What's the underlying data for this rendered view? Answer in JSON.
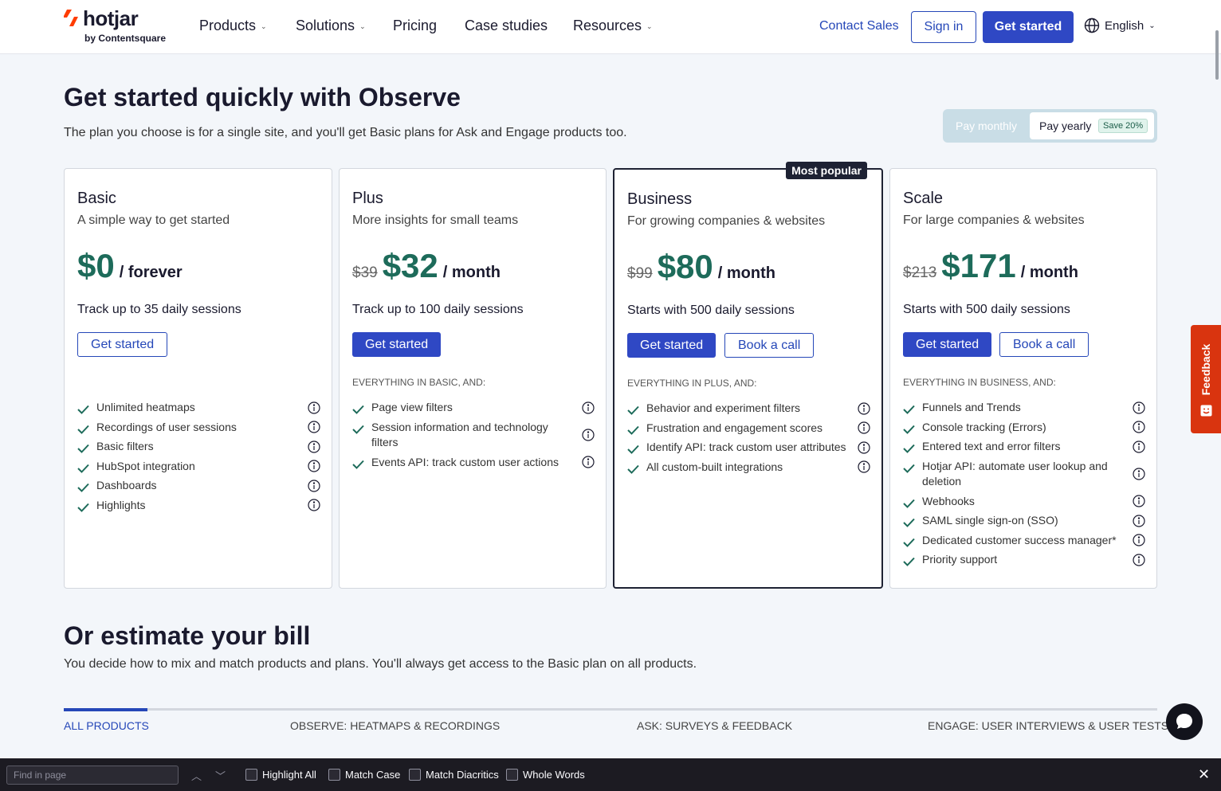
{
  "nav": {
    "logo": "hotjar",
    "logo_sub": "by Contentsquare",
    "items": [
      "Products",
      "Solutions",
      "Pricing",
      "Case studies",
      "Resources"
    ],
    "contact": "Contact Sales",
    "signin": "Sign in",
    "get_started": "Get started",
    "language": "English"
  },
  "hero": {
    "title": "Get started quickly with Observe",
    "subtitle": "The plan you choose is for a single site, and you'll get Basic plans for Ask and Engage products too."
  },
  "billing_toggle": {
    "monthly": "Pay monthly",
    "yearly": "Pay yearly",
    "save": "Save 20%",
    "selected": "Pay yearly"
  },
  "plans": [
    {
      "name": "Basic",
      "desc": "A simple way to get started",
      "old_price": "",
      "price": "$0",
      "period": "/ forever",
      "sessions": "Track up to 35 daily sessions",
      "primary": "Get started",
      "secondary": "",
      "everything": "",
      "badge": "",
      "features": [
        "Unlimited heatmaps",
        "Recordings of user sessions",
        "Basic filters",
        "HubSpot integration",
        "Dashboards",
        "Highlights"
      ]
    },
    {
      "name": "Plus",
      "desc": "More insights for small teams",
      "old_price": "$39",
      "price": "$32",
      "period": "/ month",
      "sessions": "Track up to 100 daily sessions",
      "primary": "Get started",
      "secondary": "",
      "everything": "EVERYTHING IN BASIC, AND:",
      "badge": "",
      "features": [
        "Page view filters",
        "Session information and technology filters",
        "Events API: track custom user actions"
      ]
    },
    {
      "name": "Business",
      "desc": "For growing companies & websites",
      "old_price": "$99",
      "price": "$80",
      "period": "/ month",
      "sessions": "Starts with 500 daily sessions",
      "primary": "Get started",
      "secondary": "Book a call",
      "everything": "EVERYTHING IN PLUS, AND:",
      "badge": "Most popular",
      "features": [
        "Behavior and experiment filters",
        "Frustration and engagement scores",
        "Identify API: track custom user attributes",
        "All custom-built integrations"
      ]
    },
    {
      "name": "Scale",
      "desc": "For large companies & websites",
      "old_price": "$213",
      "price": "$171",
      "period": "/ month",
      "sessions": "Starts with 500 daily sessions",
      "primary": "Get started",
      "secondary": "Book a call",
      "everything": "EVERYTHING IN BUSINESS, AND:",
      "badge": "",
      "features": [
        "Funnels and Trends",
        "Console tracking (Errors)",
        "Entered text and error filters",
        "Hotjar API: automate user lookup and deletion",
        "Webhooks",
        "SAML single sign-on (SSO)",
        "Dedicated customer success manager*",
        "Priority support"
      ]
    }
  ],
  "estimate": {
    "title": "Or estimate your bill",
    "subtitle": "You decide how to mix and match products and plans. You'll always get access to the Basic plan on all products.",
    "tabs": [
      "ALL PRODUCTS",
      "OBSERVE: HEATMAPS & RECORDINGS",
      "ASK: SURVEYS & FEEDBACK",
      "ENGAGE: USER INTERVIEWS & USER TESTS"
    ],
    "active_tab": "ALL PRODUCTS"
  },
  "feedback_tab": "Feedback",
  "findbar": {
    "placeholder": "Find in page",
    "highlight_all": "Highlight All",
    "match_case": "Match Case",
    "match_diacritics": "Match Diacritics",
    "whole_words": "Whole Words"
  },
  "colors": {
    "brand_blue": "#2f48c4",
    "price_green": "#1d6b5a",
    "feedback_orange": "#d9340f",
    "logo_red": "#ff3c00"
  },
  "icons": {
    "feature": "check-icon",
    "feature_info": "info-icon",
    "language": "globe-icon",
    "chat": "chat-bubble-icon"
  }
}
